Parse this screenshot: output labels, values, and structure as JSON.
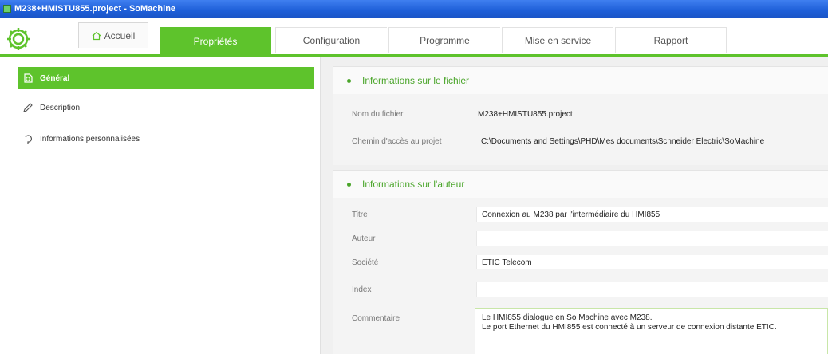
{
  "window": {
    "title": "M238+HMISTU855.project - SoMachine"
  },
  "tabs": {
    "home": "Accueil",
    "items": [
      "Propriétés",
      "Configuration",
      "Programme",
      "Mise en service",
      "Rapport"
    ],
    "active": "Propriétés"
  },
  "sidebar": {
    "items": [
      {
        "label": "Général",
        "icon": "document-icon"
      },
      {
        "label": "Description",
        "icon": "pencil-icon"
      },
      {
        "label": "Informations personnalisées",
        "icon": "custom-info-icon"
      }
    ]
  },
  "file_section": {
    "title": "Informations sur le fichier",
    "fields": [
      {
        "label": "Nom du fichier",
        "value": "M238+HMISTU855.project"
      },
      {
        "label": "Chemin d'accès au projet",
        "value": "C:\\Documents and Settings\\PHD\\Mes documents\\Schneider Electric\\SoMachine"
      }
    ]
  },
  "author_section": {
    "title": "Informations sur l'auteur",
    "fields": [
      {
        "label": "Titre",
        "value": "Connexion au M238 par l'intermédiaire du HMI855"
      },
      {
        "label": "Auteur",
        "value": ""
      },
      {
        "label": "Société",
        "value": "ETIC Telecom"
      },
      {
        "label": "Index",
        "value": ""
      },
      {
        "label": "Commentaire",
        "value": "Le HMI855 dialogue en So Machine avec M238.\nLe port Ethernet du HMI855 est connecté à un serveur de connexion distante ETIC."
      }
    ]
  },
  "colors": {
    "accent": "#5ec32c",
    "titlebar": "#1e5fd8",
    "section_title": "#4aa52a"
  }
}
